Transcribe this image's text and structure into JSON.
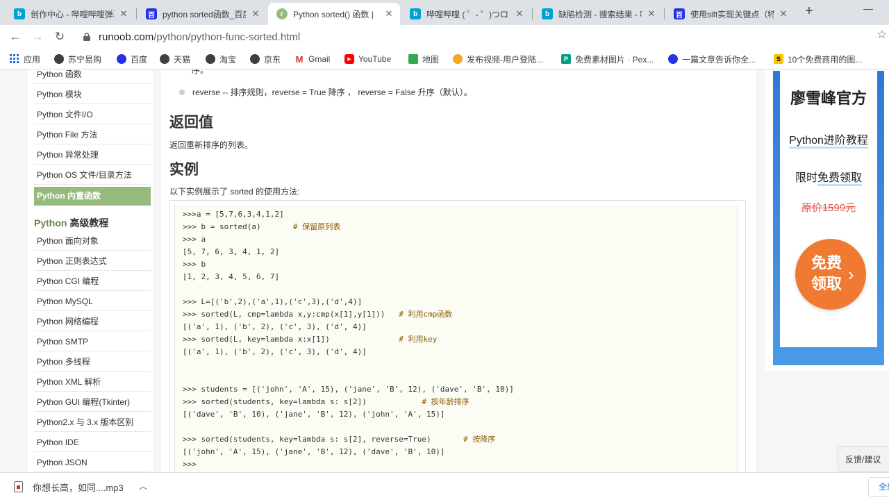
{
  "browser": {
    "tabs": [
      {
        "title": "创作中心 - 哔哩哔哩弹幕",
        "icon": "bilibili-icon",
        "color": "#00a1d6"
      },
      {
        "title": "python sorted函数_百度",
        "icon": "baidu-icon",
        "color": "#2932e1"
      },
      {
        "title": "Python sorted() 函数 |",
        "icon": "runoob-icon",
        "color": "#96b97d"
      },
      {
        "title": "哔哩哔哩 ( ゜- ゜)つロ 干",
        "icon": "bilibili-icon",
        "color": "#00a1d6"
      },
      {
        "title": "缺陷检测 - 搜索结果 - 哔",
        "icon": "bilibili-icon",
        "color": "#00a1d6"
      },
      {
        "title": "使用sift实现关键点（特",
        "icon": "baidu-icon",
        "color": "#2932e1"
      }
    ],
    "new_tab": "+",
    "minimize": "—",
    "url_host": "runoob.com",
    "url_path": "/python/python-func-sorted.html",
    "bookmarks": [
      {
        "label": "应用",
        "icon": "apps-grid-icon",
        "color": "#1a73e8"
      },
      {
        "label": "苏宁易购",
        "icon": "globe-icon",
        "color": "#3c4043"
      },
      {
        "label": "百度",
        "icon": "baidu-paw-icon",
        "color": "#2932e1"
      },
      {
        "label": "天猫",
        "icon": "globe-icon",
        "color": "#3c4043"
      },
      {
        "label": "淘宝",
        "icon": "globe-icon",
        "color": "#3c4043"
      },
      {
        "label": "京东",
        "icon": "globe-icon",
        "color": "#3c4043"
      },
      {
        "label": "Gmail",
        "icon": "gmail-icon",
        "color": "#d93025"
      },
      {
        "label": "YouTube",
        "icon": "youtube-icon",
        "color": "#ff0000"
      },
      {
        "label": "地图",
        "icon": "maps-icon",
        "color": "#34a853"
      },
      {
        "label": "发布视频-用户登陆...",
        "icon": "upload-icon",
        "color": "#f5a623"
      },
      {
        "label": "免费素材图片 · Pex...",
        "icon": "pexels-icon",
        "color": "#05a081"
      },
      {
        "label": "一篇文章告诉你全...",
        "icon": "baidu-paw-icon",
        "color": "#2932e1"
      },
      {
        "label": "10个免费商用的图...",
        "icon": "s-logo-icon",
        "color": "#f7c600"
      }
    ]
  },
  "sidebar": {
    "items_top": [
      "Python 函数",
      "Python 模块",
      "Python 文件I/O",
      "Python File 方法",
      "Python 异常处理",
      "Python OS 文件/目录方法",
      "Python 内置函数"
    ],
    "active_index": 6,
    "section_heading_green": "Python",
    "section_heading_rest": " 高级教程",
    "items_advanced": [
      "Python 面向对象",
      "Python 正则表达式",
      "Python CGI 编程",
      "Python MySQL",
      "Python 网络编程",
      "Python SMTP",
      "Python 多线程",
      "Python XML 解析",
      "Python GUI 编程(Tkinter)",
      "Python2.x 与 3.x 版本区别",
      "Python IDE",
      "Python JSON"
    ]
  },
  "article": {
    "partial_line": "序。",
    "reverse_desc": "reverse -- 排序规则，reverse = True 降序 ， reverse = False 升序（默认）。",
    "return_heading": "返回值",
    "return_text": "返回重新排序的列表。",
    "example_heading": "实例",
    "example_intro": "以下实例展示了 sorted 的使用方法:",
    "code_lines": [
      {
        "code": ">>>a = [5,7,6,3,4,1,2]",
        "comment": ""
      },
      {
        "code": ">>> b = sorted(a)       ",
        "comment": "# 保留原列表"
      },
      {
        "code": ">>> a",
        "comment": ""
      },
      {
        "code": "[5, 7, 6, 3, 4, 1, 2]",
        "comment": ""
      },
      {
        "code": ">>> b",
        "comment": ""
      },
      {
        "code": "[1, 2, 3, 4, 5, 6, 7]",
        "comment": ""
      },
      {
        "code": "",
        "comment": ""
      },
      {
        "code": ">>> L=[('b',2),('a',1),('c',3),('d',4)]",
        "comment": ""
      },
      {
        "code": ">>> sorted(L, cmp=lambda x,y:cmp(x[1],y[1]))   ",
        "comment": "# 利用cmp函数"
      },
      {
        "code": "[('a', 1), ('b', 2), ('c', 3), ('d', 4)]",
        "comment": ""
      },
      {
        "code": ">>> sorted(L, key=lambda x:x[1])               ",
        "comment": "# 利用key"
      },
      {
        "code": "[('a', 1), ('b', 2), ('c', 3), ('d', 4)]",
        "comment": ""
      },
      {
        "code": "",
        "comment": ""
      },
      {
        "code": "",
        "comment": ""
      },
      {
        "code": ">>> students = [('john', 'A', 15), ('jane', 'B', 12), ('dave', 'B', 10)]",
        "comment": ""
      },
      {
        "code": ">>> sorted(students, key=lambda s: s[2])            ",
        "comment": "# 按年龄排序"
      },
      {
        "code": "[('dave', 'B', 10), ('jane', 'B', 12), ('john', 'A', 15)]",
        "comment": ""
      },
      {
        "code": "",
        "comment": ""
      },
      {
        "code": ">>> sorted(students, key=lambda s: s[2], reverse=True)       ",
        "comment": "# 按降序"
      },
      {
        "code": "[('john', 'A', 15), ('jane', 'B', 12), ('dave', 'B', 10)]",
        "comment": ""
      },
      {
        "code": ">>>",
        "comment": ""
      }
    ]
  },
  "ad": {
    "title": "廖雪峰官方",
    "subtitle": "Python进阶教程",
    "offer_prefix": "限时",
    "offer_highlight": "免费领取",
    "price": "原价1599元",
    "button_line1": "免费",
    "button_line2": "领取",
    "colors": {
      "button": "#f07a31",
      "price": "#e4534b",
      "background": "#2c7ad6"
    }
  },
  "feedback": "反馈/建议",
  "downloads": {
    "file_name": "你想长高，如同....mp3",
    "show_all": "全部"
  },
  "colors": {
    "accent_green": "#96b97d",
    "heading_green": "#64854c"
  }
}
